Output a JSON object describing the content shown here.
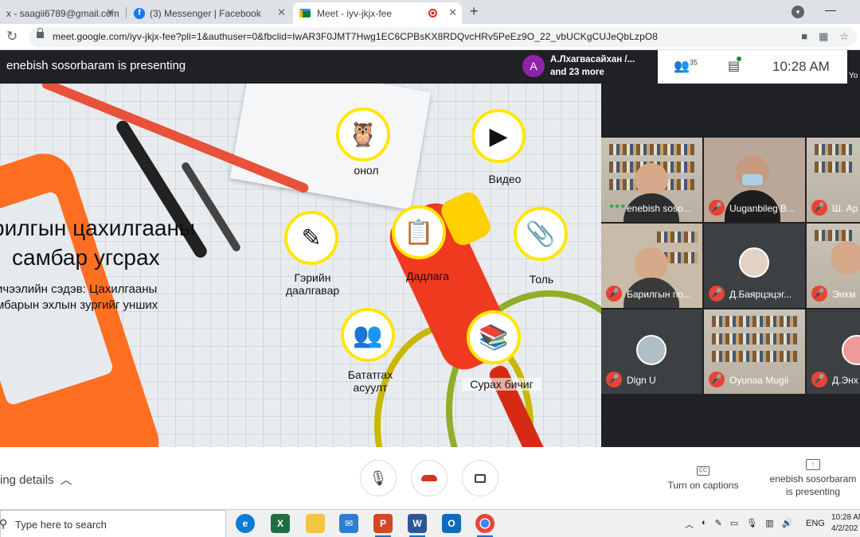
{
  "tabs": [
    {
      "title": "x - saagii6789@gmail.com -",
      "icon": "gmail-icon"
    },
    {
      "title": "(3) Messenger | Facebook",
      "icon": "facebook-icon"
    },
    {
      "title": "Meet - iyv-jkjx-fee",
      "icon": "meet-icon",
      "recording": true
    }
  ],
  "address": {
    "url": "meet.google.com/iyv-jkjx-fee?pli=1&authuser=0&fbclid=IwAR3F0JMT7Hwg1EC6CPBsKX8RDQvcHRv5PeEz9O_22_vbUCKgCUJeQbLzpO8"
  },
  "meet": {
    "presenting_banner": "enebish sosorbaram is presenting",
    "participant_card": {
      "avatar": "A",
      "line1": "А.Лхагвасайхан /...",
      "line2": "and 23 more"
    },
    "participants_count": "35",
    "time": "10:28  AM",
    "you_label": "Yo"
  },
  "slide": {
    "title_line1": "рилгын цахилгааны",
    "title_line2": "самбар угсрах",
    "subtitle_line1": "ичээлийн сэдэв: Цахилгааны",
    "subtitle_line2": "мбарын эхлын зургийг унших",
    "buttons": [
      {
        "label": "онол",
        "icon": "owl-icon"
      },
      {
        "label": "Видео",
        "icon": "video-presentation-icon"
      },
      {
        "label": "Гэрийн даалгавар",
        "icon": "pencil-icon"
      },
      {
        "label": "Дадлага",
        "icon": "teacher-board-icon"
      },
      {
        "label": "Толь",
        "icon": "paperclip-icon"
      },
      {
        "label": "Бататгах асуулт",
        "icon": "question-people-icon"
      },
      {
        "label": "Сурах бичиг",
        "icon": "books-icon"
      }
    ]
  },
  "tiles": [
    {
      "name": "enebish soso...",
      "muted": false,
      "speaking": true
    },
    {
      "name": "Uuganbileg B...",
      "muted": true
    },
    {
      "name": "Ш. Ар",
      "muted": true
    },
    {
      "name": "Барилгын по...",
      "muted": true
    },
    {
      "name": "Д.Баярцэцэг...",
      "muted": true
    },
    {
      "name": "Энхм",
      "muted": true
    },
    {
      "name": "Dlgn U",
      "muted": true
    },
    {
      "name": "Oyunaa Mugii",
      "muted": true
    },
    {
      "name": "Д.Энх",
      "muted": true
    }
  ],
  "controls": {
    "details_label": "ing details",
    "captions_label": "Turn on captions",
    "presenting_label": "enebish sosorbaram is presenting"
  },
  "taskbar": {
    "search_placeholder": "Type here to search",
    "lang": "ENG",
    "time": "10:28 AM",
    "date": "4/2/202"
  }
}
